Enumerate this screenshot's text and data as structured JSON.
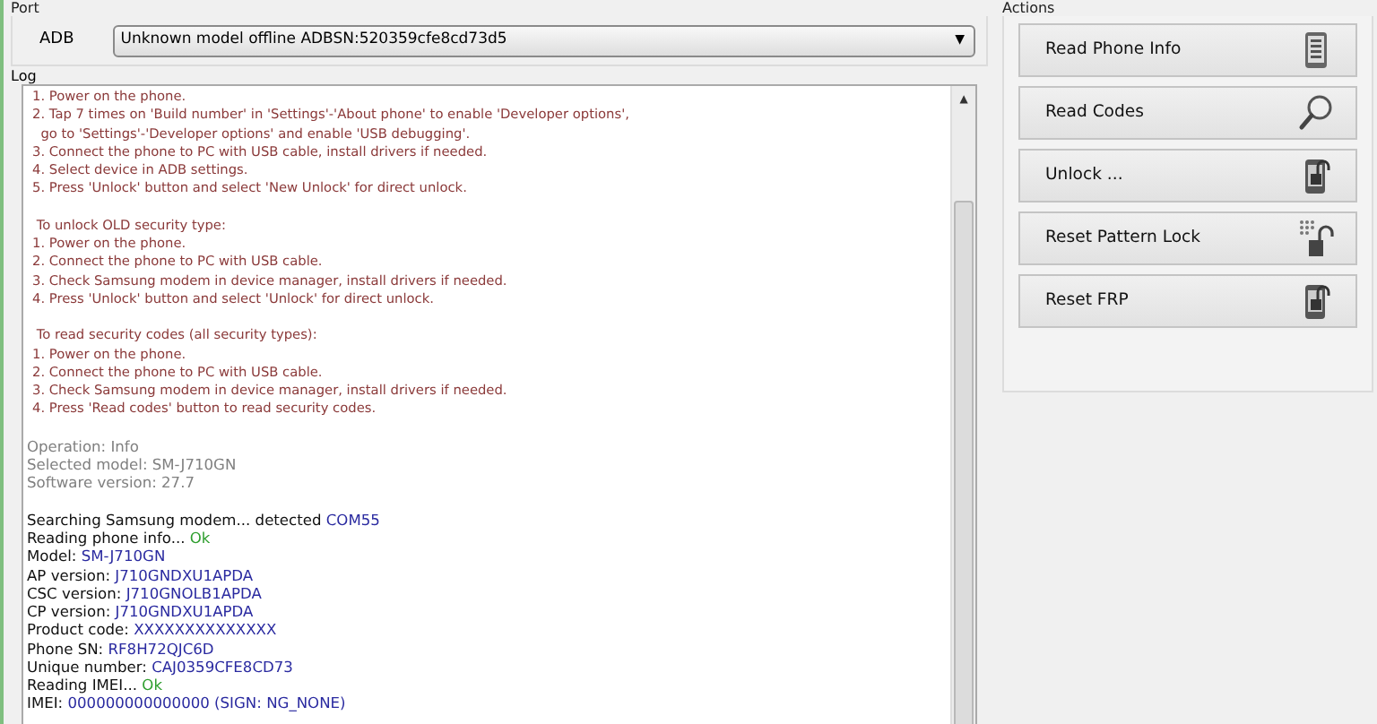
{
  "port": {
    "title": "Port",
    "label": "ADB",
    "selected_device": "Unknown model offline ADBSN:520359cfe8cd73d5",
    "dropdown_arrow": "▼"
  },
  "log": {
    "title": "Log",
    "scroll_up": "▲",
    "lines": [
      {
        "kind": "instruction",
        "text": "1. Power on the phone."
      },
      {
        "kind": "instruction",
        "text": "2. Tap 7 times on 'Build number' in 'Settings'-'About phone' to enable 'Developer options',"
      },
      {
        "kind": "instruction",
        "text": "  go to 'Settings'-'Developer options' and enable 'USB debugging'."
      },
      {
        "kind": "instruction",
        "text": "3. Connect the phone to PC with USB cable, install drivers if needed."
      },
      {
        "kind": "instruction",
        "text": "4. Select device in ADB settings."
      },
      {
        "kind": "instruction",
        "text": "5. Press 'Unlock' button and select 'New Unlock' for direct unlock."
      },
      {
        "kind": "blank"
      },
      {
        "kind": "instruction",
        "text": " To unlock OLD security type:"
      },
      {
        "kind": "instruction",
        "text": "1. Power on the phone."
      },
      {
        "kind": "instruction",
        "text": "2. Connect the phone to PC with USB cable."
      },
      {
        "kind": "instruction",
        "text": "3. Check Samsung modem in device manager, install drivers if needed."
      },
      {
        "kind": "instruction",
        "text": "4. Press 'Unlock' button and select 'Unlock' for direct unlock."
      },
      {
        "kind": "blank"
      },
      {
        "kind": "instruction",
        "text": " To read security codes (all security types):"
      },
      {
        "kind": "instruction",
        "text": "1. Power on the phone."
      },
      {
        "kind": "instruction",
        "text": "2. Connect the phone to PC with USB cable."
      },
      {
        "kind": "instruction",
        "text": "3. Check Samsung modem in device manager, install drivers if needed."
      },
      {
        "kind": "instruction",
        "text": "4. Press 'Read codes' button to read security codes."
      },
      {
        "kind": "blank"
      },
      {
        "kind": "info",
        "text": "Operation: Info"
      },
      {
        "kind": "info",
        "text": "Selected model: SM-J710GN"
      },
      {
        "kind": "info",
        "text": "Software version: 27.7"
      },
      {
        "kind": "blank"
      },
      {
        "kind": "plain",
        "text": "Searching Samsung modem... detected",
        "value": "COM55"
      },
      {
        "kind": "status",
        "text": "Reading phone info...",
        "value": "Ok"
      },
      {
        "kind": "plain",
        "text": "Model:",
        "value": "SM-J710GN"
      },
      {
        "kind": "plain",
        "text": "AP version:",
        "value": "J710GNDXU1APDA"
      },
      {
        "kind": "plain",
        "text": "CSC version:",
        "value": "J710GNOLB1APDA"
      },
      {
        "kind": "plain",
        "text": "CP version:",
        "value": "J710GNDXU1APDA"
      },
      {
        "kind": "plain",
        "text": "Product code:",
        "value": "XXXXXXXXXXXXXX"
      },
      {
        "kind": "plain",
        "text": "Phone SN:",
        "value": "RF8H72QJC6D"
      },
      {
        "kind": "plain",
        "text": "Unique number:",
        "value": "CAJ0359CFE8CD73"
      },
      {
        "kind": "status",
        "text": "Reading IMEI...",
        "value": "Ok"
      },
      {
        "kind": "plain",
        "text": "IMEI:",
        "value": "000000000000000 (SIGN: NG_NONE)"
      }
    ]
  },
  "actions": {
    "title": "Actions",
    "buttons": [
      {
        "label": "Read Phone Info",
        "kind": "phone-info"
      },
      {
        "label": "Read Codes",
        "kind": "magnifier"
      },
      {
        "label": "Unlock ...",
        "kind": "phone-lock"
      },
      {
        "label": "Reset Pattern Lock",
        "kind": "pattern-lock"
      },
      {
        "label": "Reset FRP",
        "kind": "phone-lock"
      }
    ]
  }
}
